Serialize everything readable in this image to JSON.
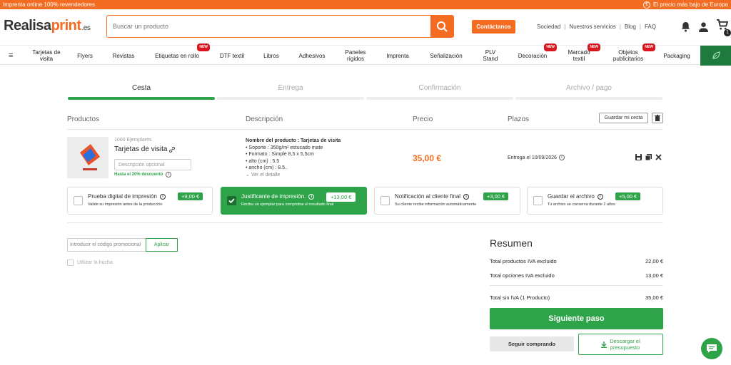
{
  "banner": {
    "left": "Imprenta online 100% revendedores",
    "right": "El precio más bajo de Europa",
    "right_icon": "euro-icon"
  },
  "header": {
    "logo_prefix": "Realisa",
    "logo_suffix": "print",
    "logo_tld": ".es",
    "search_placeholder": "Buscar un producto",
    "contact_label": "Contáctanos",
    "links": [
      "Sociedad",
      "Nuestros servicios",
      "Blog",
      "FAQ"
    ],
    "cart_count": "1"
  },
  "nav": {
    "items": [
      {
        "label": "Tarjetas de visita",
        "new": ""
      },
      {
        "label": "Flyers",
        "new": ""
      },
      {
        "label": "Revistas",
        "new": ""
      },
      {
        "label": "Etiquetas en rollo",
        "new": "NEW"
      },
      {
        "label": "DTF textil",
        "new": ""
      },
      {
        "label": "Libros",
        "new": ""
      },
      {
        "label": "Adhesivos",
        "new": ""
      },
      {
        "label": "Paneles rígidos",
        "new": ""
      },
      {
        "label": "Imprenta",
        "new": ""
      },
      {
        "label": "Señalización",
        "new": ""
      },
      {
        "label": "PLV Stand",
        "new": ""
      },
      {
        "label": "Decoración",
        "new": "NEW"
      },
      {
        "label": "Marcado textil",
        "new": "NEW"
      },
      {
        "label": "Objetos publicitarios",
        "new": "NEW"
      },
      {
        "label": "Packaging",
        "new": ""
      }
    ]
  },
  "steps": [
    {
      "label": "Cesta",
      "active": true
    },
    {
      "label": "Entrega",
      "active": false
    },
    {
      "label": "Confirmación",
      "active": false
    },
    {
      "label": "Archivo / pago",
      "active": false
    }
  ],
  "table": {
    "headers": {
      "products": "Productos",
      "description": "Descripción",
      "price": "Precio",
      "deadline": "Plazos"
    },
    "save_cart": "Guardar mi cesta"
  },
  "product": {
    "quantity": "1000 Ejemplares",
    "name": "Tarjetas de visita",
    "optional_placeholder": "Descripción opcional",
    "discount": "Hasta el 20% descuento",
    "desc_title": "Nombre del producto : Tarjetas de visita",
    "desc_lines": [
      "• Soporte : 350g/m² estucado mate",
      "• Formato : Simple 8,5 x 5,5cm",
      "• alto (cm) : 5.5",
      "• ancho (cm) : 8.5.."
    ],
    "see_detail": "Ver el detalle",
    "price": "35,00 €",
    "delivery": "Entrega el 10/09/2026"
  },
  "options": [
    {
      "title": "Prueba digital de impresión",
      "price": "+9,00 €",
      "sub": "Valide su impresión antes de la producción",
      "checked": false
    },
    {
      "title": "Justificante de impresión.",
      "price": "+13,00 €",
      "sub": "Reciba un ejemplar para comprobar el resultado final",
      "checked": true
    },
    {
      "title": "Notificación al cliente final",
      "price": "+3,00 €",
      "sub": "Su cliente recibe información automáticamente",
      "checked": false
    },
    {
      "title": "Guardar el archivo",
      "price": "+5,00 €",
      "sub": "Tu archivo se conserva durante 2 años",
      "checked": false
    }
  ],
  "promo": {
    "placeholder": "Introducir el código promocional",
    "apply": "Aplicar",
    "use_hucha": "Utilizar la hucha"
  },
  "summary": {
    "title": "Resumen",
    "rows": [
      {
        "label": "Total productos IVA excluido",
        "value": "22,00 €"
      },
      {
        "label": "Total opciones IVA excluido",
        "value": "13,00 €"
      },
      {
        "label": "Total sin IVA (1 Producto)",
        "value": "35,00 €"
      }
    ],
    "next": "Siguiente paso",
    "continue": "Seguir comprando",
    "download_line1": "Descargar el",
    "download_line2": "presupuesto"
  },
  "colors": {
    "orange": "#f36c21",
    "green": "#2ea34a",
    "dark_green": "#1f7a3e"
  }
}
